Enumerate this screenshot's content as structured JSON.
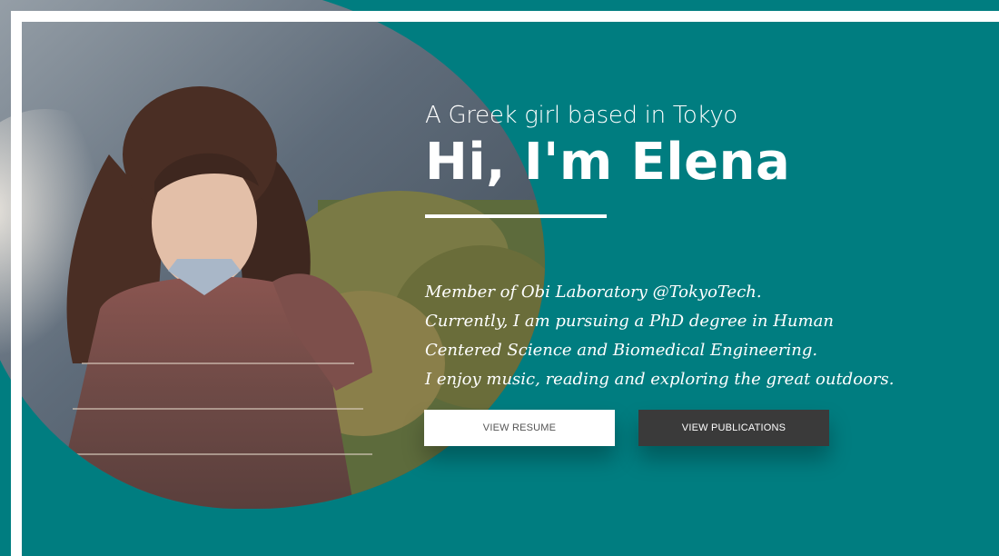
{
  "hero": {
    "subtitle": "A Greek girl based in Tokyo",
    "title": "Hi, I'm Elena",
    "bio_lines": [
      "Member of Obi Laboratory @TokyoTech.",
      "Currently, I am pursuing a PhD degree in Human",
      "Centered Science and Biomedical Engineering.",
      "I enjoy music, reading and exploring the great outdoors."
    ]
  },
  "buttons": {
    "resume_label": "VIEW RESUME",
    "publications_label": "VIEW PUBLICATIONS"
  },
  "colors": {
    "background": "#007d80",
    "frame": "#ffffff",
    "button_dark": "#3a3a3a"
  }
}
